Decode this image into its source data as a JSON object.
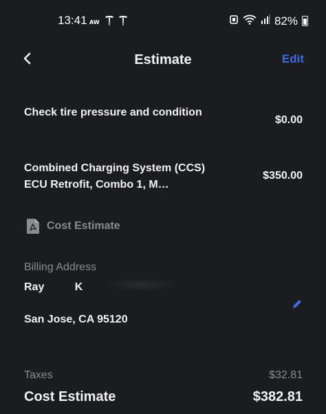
{
  "status_bar": {
    "time": "13:41",
    "left_icons": [
      "aw-icon",
      "tesla-icon",
      "tesla-icon"
    ],
    "battery_percent": "82%"
  },
  "header": {
    "title": "Estimate",
    "edit_label": "Edit"
  },
  "line_items": [
    {
      "description": "Check tire pressure and condition",
      "price": "$0.00"
    },
    {
      "description": "Combined Charging System (CCS) ECU Retrofit, Combo 1, M…",
      "price": "$350.00"
    }
  ],
  "document": {
    "label": "Cost Estimate",
    "icon": "pdf-icon"
  },
  "billing": {
    "label": "Billing Address",
    "name": "Ray K",
    "city_line": "San Jose, CA 95120"
  },
  "totals": {
    "taxes_label": "Taxes",
    "taxes_value": "$32.81",
    "total_label": "Cost Estimate",
    "total_value": "$382.81"
  },
  "colors": {
    "background": "#1b1c1f",
    "accent": "#3e6ae1",
    "muted": "#8a8b8e",
    "text": "#f2f2f2"
  }
}
